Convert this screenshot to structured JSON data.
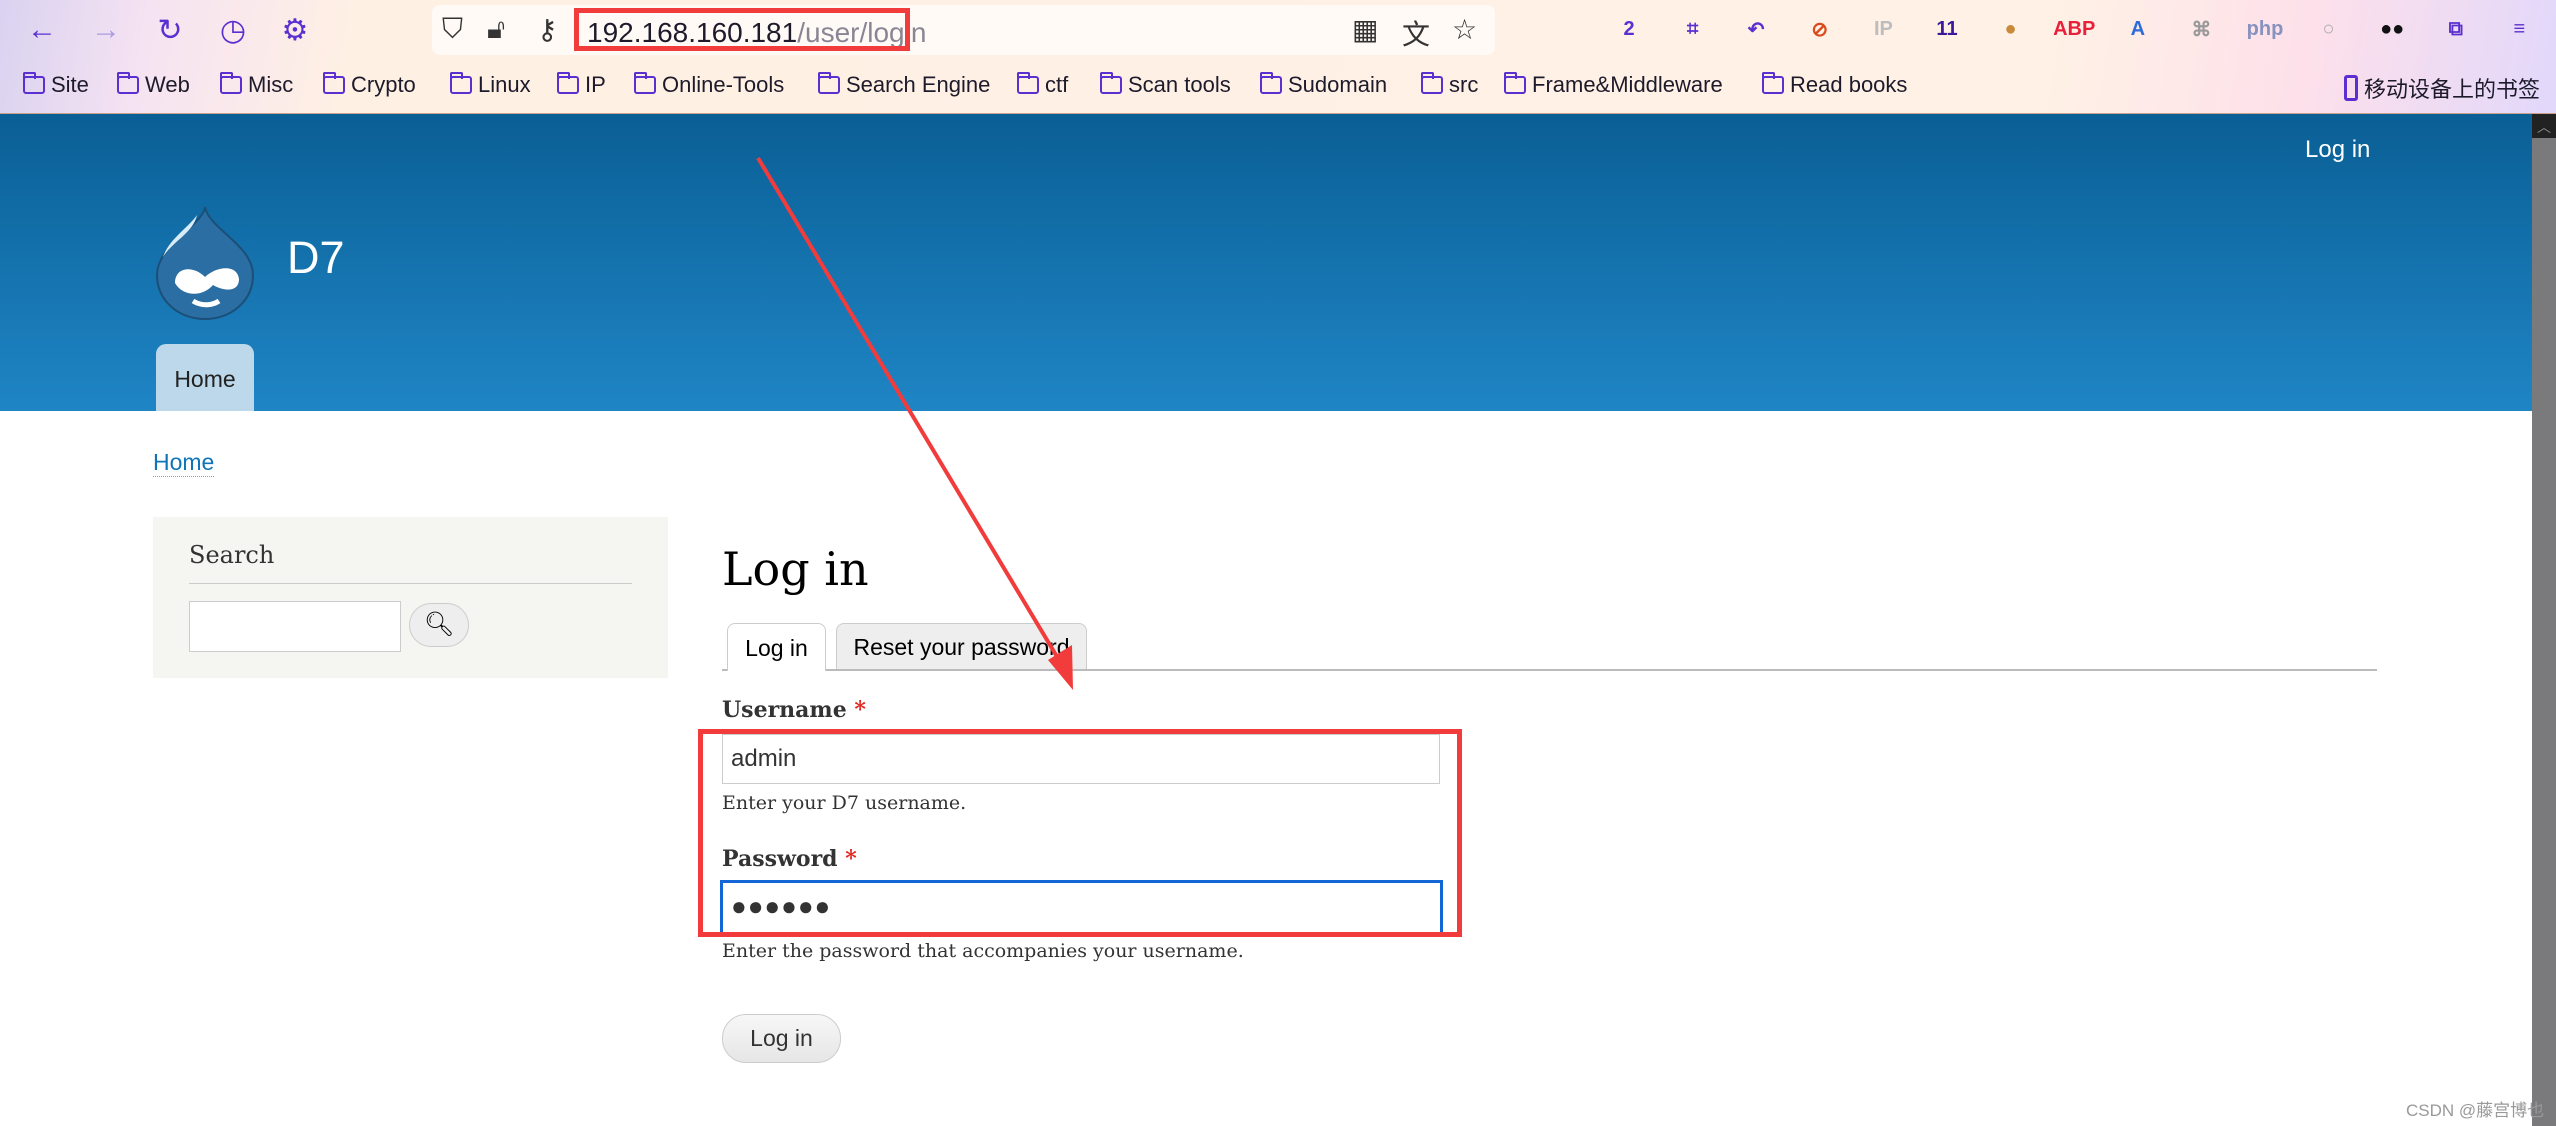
{
  "browser": {
    "url_host": "192.168.160.181",
    "url_path": "/user/login",
    "nav_icons": [
      "back-icon",
      "forward-icon",
      "reload-icon",
      "history-icon",
      "settings-icon"
    ],
    "extensions": [
      {
        "name": "badge-2-extension",
        "label": "2",
        "color": "#5b2fd0"
      },
      {
        "name": "crop-extension",
        "label": "⌗",
        "color": "#5b2fd0"
      },
      {
        "name": "undo-extension",
        "label": "↶",
        "color": "#5b2fd0"
      },
      {
        "name": "blocked-extension",
        "label": "⊘",
        "color": "#d94a1c"
      },
      {
        "name": "ip-extension",
        "label": "IP",
        "color": "#bdbdbd"
      },
      {
        "name": "download-extension",
        "label": "11",
        "color": "#3a1a9a"
      },
      {
        "name": "cookie-extension",
        "label": "●",
        "color": "#c98a3a"
      },
      {
        "name": "adblock-extension",
        "label": "ABP",
        "color": "#e8203a"
      },
      {
        "name": "translate-extension",
        "label": "A",
        "color": "#2d6bd8"
      },
      {
        "name": "paused-extension",
        "label": "⌘",
        "color": "#9a9a9a"
      },
      {
        "name": "php-extension",
        "label": "php",
        "color": "#8892bf"
      },
      {
        "name": "circle-extension",
        "label": "○",
        "color": "#aaaaaa"
      },
      {
        "name": "mask-extension",
        "label": "●●",
        "color": "#111111"
      },
      {
        "name": "extensions-puzzle",
        "label": "⧉",
        "color": "#5b2fd0"
      },
      {
        "name": "menu",
        "label": "≡",
        "color": "#5b2fd0"
      }
    ]
  },
  "bookmarks": [
    "Site",
    "Web",
    "Misc",
    "Crypto",
    "Linux",
    "IP",
    "Online-Tools",
    "Search Engine",
    "ctf",
    "Scan tools",
    "Sudomain",
    "src",
    "Frame&Middleware",
    "Read books"
  ],
  "mobile_bookmarks": "移动设备上的书签",
  "site": {
    "name": "D7",
    "user_link": "Log in",
    "menu_home": "Home",
    "breadcrumb_home": "Home",
    "sidebar_title": "Search",
    "search_placeholder": ""
  },
  "page": {
    "title": "Log in",
    "tabs": [
      {
        "label": "Log in",
        "active": true
      },
      {
        "label": "Reset your password",
        "active": false
      }
    ],
    "username_label": "Username",
    "required_mark": "*",
    "username_value": "admin",
    "username_desc": "Enter your D7 username.",
    "password_label": "Password",
    "password_value": "●●●●●●",
    "password_desc": "Enter the password that accompanies your username.",
    "submit_label": "Log in"
  },
  "annotation_color": "#f23b3b",
  "watermark": "CSDN @藤宫博也"
}
